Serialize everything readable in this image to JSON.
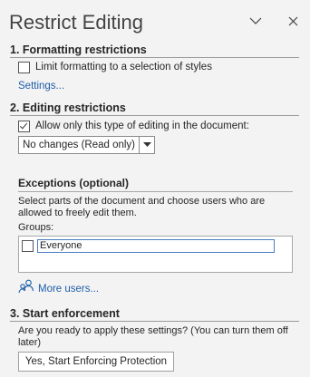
{
  "pane": {
    "title": "Restrict Editing",
    "header_icons": [
      "chevron-down-icon",
      "close-icon"
    ]
  },
  "formatting": {
    "heading": "1. Formatting restrictions",
    "checkbox_label": "Limit formatting to a selection of styles",
    "checked": false,
    "settings_link": "Settings..."
  },
  "editing": {
    "heading": "2. Editing restrictions",
    "checkbox_label": "Allow only this type of editing in the document:",
    "checked": true,
    "dropdown_value": "No changes (Read only)"
  },
  "exceptions": {
    "heading": "Exceptions (optional)",
    "description_line1": "Select parts of the document and choose users who are",
    "description_line2": "allowed to freely edit them.",
    "groups_label": "Groups:",
    "groups": [
      {
        "name": "Everyone",
        "checked": false
      }
    ],
    "more_users_link": "More users..."
  },
  "enforcement": {
    "heading": "3. Start enforcement",
    "question_line1": "Are you ready to apply these settings? (You can turn them off",
    "question_line2": "later)",
    "button_label": "Yes, Start Enforcing Protection"
  },
  "colors": {
    "background": "#f3f3f3",
    "link": "#1f5ea8",
    "focus_border": "#4a7bbf"
  }
}
